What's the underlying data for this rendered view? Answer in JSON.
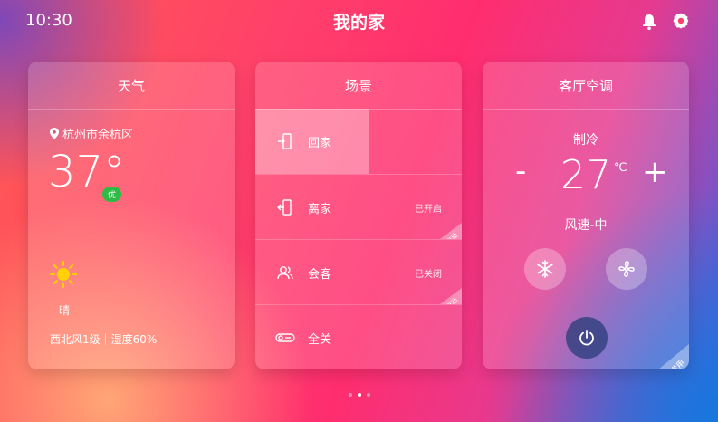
{
  "status_bar": {
    "time": "10:30"
  },
  "header": {
    "title": "我的家"
  },
  "weather": {
    "title": "天气",
    "location": "杭州市余杭区",
    "temperature": "37°",
    "aqi_label": "优",
    "condition": "晴",
    "details": "西北风1级｜湿度60%",
    "icons": {
      "location": "location-pin-icon",
      "weather": "sun-icon"
    }
  },
  "scenes": {
    "title": "场景",
    "items": [
      {
        "label": "回家",
        "status": "",
        "tag": "",
        "icon": "door-enter-icon"
      },
      {
        "label": "离家",
        "status": "已开启",
        "tag": "自动",
        "icon": "door-exit-icon"
      },
      {
        "label": "会客",
        "status": "已关闭",
        "tag": "自动",
        "icon": "guests-icon"
      },
      {
        "label": "全关",
        "status": "",
        "tag": "",
        "icon": "toggle-off-icon"
      }
    ]
  },
  "ac": {
    "title": "客厅空调",
    "mode": "制冷",
    "temperature": "27",
    "unit": "℃",
    "minus": "-",
    "plus": "+",
    "fan": "风速-中",
    "tag": "常用",
    "icons": {
      "cool": "snowflake-icon",
      "fan": "fan-icon",
      "power": "power-icon"
    }
  },
  "pagination": {
    "pages": 3,
    "current": 2
  },
  "colors": {
    "aqi_good": "#2dbb45"
  }
}
